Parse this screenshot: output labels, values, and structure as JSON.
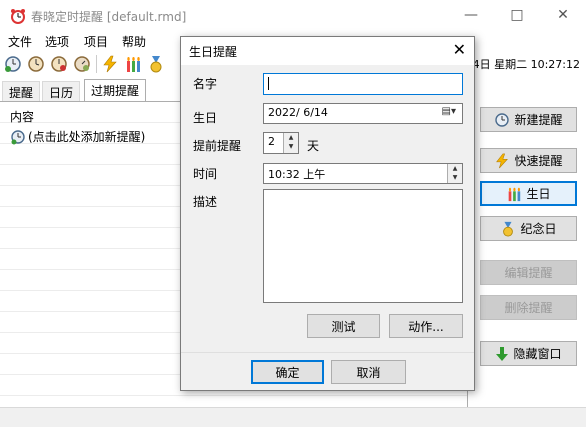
{
  "window": {
    "title": "春晓定时提醒 [default.rmd]",
    "icon": "alarm-clock-icon",
    "controls": [
      "minimize",
      "maximize",
      "close"
    ]
  },
  "menu": [
    "文件",
    "选项",
    "项目",
    "帮助"
  ],
  "toolbar_icons": [
    "add-reminder-icon",
    "clock-icon",
    "alarm-icon",
    "alarm-settings-icon",
    "lightning-icon",
    "birthday-candles-icon",
    "medal-icon"
  ],
  "datetime": "4日 星期二 10:27:12",
  "tabs": [
    "提醒",
    "日历",
    "过期提醒"
  ],
  "list": {
    "header": "内容",
    "rows": [
      "(点击此处添加新提醒)"
    ]
  },
  "side_buttons": [
    {
      "label": "新建提醒",
      "icon": "clock-icon",
      "enabled": true
    },
    {
      "label": "快速提醒",
      "icon": "lightning-icon",
      "enabled": true
    },
    {
      "label": "生日",
      "icon": "birthday-candles-icon",
      "enabled": true
    },
    {
      "label": "纪念日",
      "icon": "medal-icon",
      "enabled": true
    },
    {
      "label": "编辑提醒",
      "icon": "",
      "enabled": false
    },
    {
      "label": "删除提醒",
      "icon": "",
      "enabled": false
    },
    {
      "label": "隐藏窗口",
      "icon": "down-arrow-icon",
      "enabled": true
    }
  ],
  "dialog": {
    "title": "生日提醒",
    "name_label": "名字",
    "name_value": "",
    "birthday_label": "生日",
    "birthday_value": "2022/  6/14",
    "advance_label": "提前提醒",
    "advance_value": "2",
    "advance_unit": "天",
    "time_label": "时间",
    "time_value": "10:32 上午",
    "desc_label": "描述",
    "desc_value": "",
    "test_button": "测试",
    "action_button": "动作...",
    "ok_button": "确定",
    "cancel_button": "取消"
  },
  "colors": {
    "accent": "#0078d7",
    "dialog_bg": "#f0f0f0",
    "disabled_text": "#9a9a9a"
  }
}
